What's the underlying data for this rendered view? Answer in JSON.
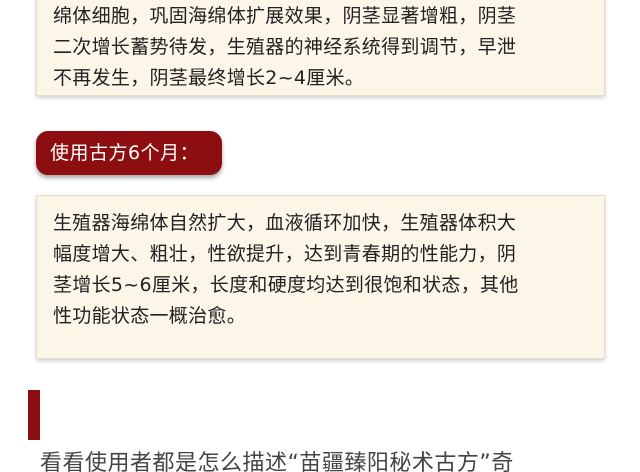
{
  "top_card": {
    "text": "绵体细胞，巩固海绵体扩展效果，阴茎显著增粗，阴茎\n二次增长蓄势待发，生殖器的神经系统得到调节，早泄\n不再发生，阴茎最终增长2~4厘米。"
  },
  "tag": {
    "label": "使用古方6个月："
  },
  "bottom_card": {
    "text": "生殖器海绵体自然扩大，血液循环加快，生殖器体积大\n幅度增大、粗壮，性欲提升，达到青春期的性能力，阴\n茎增长5~6厘米，长度和硬度均达到很饱和状态，其他\n性功能状态一概治愈。"
  },
  "footer": {
    "text": "看看使用者都是怎么描述“苗疆臻阳秘术古方”奇"
  },
  "colors": {
    "accent": "#8c0e10",
    "card_bg": "#fbf6e8"
  }
}
